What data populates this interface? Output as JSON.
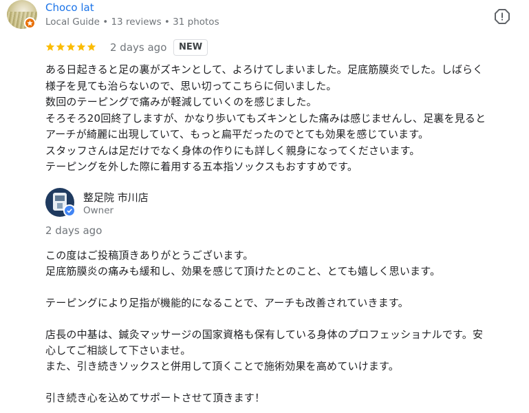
{
  "review": {
    "author": "Choco lat",
    "meta": "Local Guide • 13 reviews • 31 photos",
    "rating": 5,
    "date": "2 days ago",
    "badge": "NEW",
    "lines": [
      "ある日起きると足の裏がズキンとして、よろけてしまいました。足底筋膜炎でした。しばらく",
      "様子を見ても治らないので、思い切ってこちらに伺いました。",
      "数回のテーピングで痛みが軽減していくのを感じました。",
      "そろそろ20回終了しますが、かなり歩いてもズキンとした痛みは感じませんし、足裏を見ると",
      "アーチが綺麗に出現していて、もっと扁平だったのでとても効果を感じています。",
      "スタッフさんは足だけでなく身体の作りにも詳しく親身になってくださいます。",
      "テーピングを外した際に着用する五本指ソックスもおすすめです。"
    ]
  },
  "owner_reply": {
    "name": "整足院 市川店",
    "role": "Owner",
    "date": "2 days ago",
    "lines": [
      "この度はご投稿頂きありがとうございます。",
      "足底筋膜炎の痛みも緩和し、効果を感じて頂けたとのこと、とても嬉しく思います。",
      "",
      "テーピングにより足指が機能的になることで、アーチも改善されていきます。",
      "",
      "店長の中基は、鍼灸マッサージの国家資格も保有している身体のプロフェッショナルです。安",
      "心してご相談して下さいませ。",
      "また、引き続きソックスと併用して頂くことで施術効果を高めていけます。",
      "",
      "引き続き心を込めてサポートさせて頂きます！"
    ]
  },
  "icons": {
    "report": "report-flag-icon",
    "star": "star-icon",
    "guide": "local-guide-badge-icon",
    "verified": "verified-check-icon"
  },
  "colors": {
    "star": "#fbbc04",
    "link": "#1a73e8",
    "muted": "#70757a",
    "guide_badge": "#e8710a",
    "verified": "#4285f4"
  }
}
